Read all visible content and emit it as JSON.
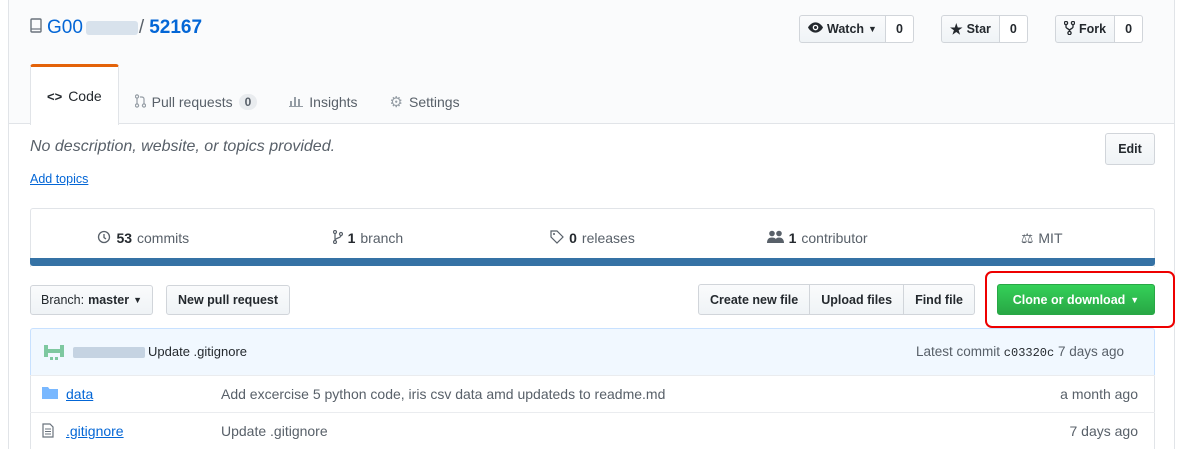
{
  "repo": {
    "owner": "G00",
    "separator": "/",
    "name": "52167"
  },
  "social": {
    "watch": {
      "label": "Watch",
      "count": "0"
    },
    "star": {
      "label": "Star",
      "count": "0"
    },
    "fork": {
      "label": "Fork",
      "count": "0"
    }
  },
  "tabs": [
    {
      "label": "Code",
      "icon": "code-icon"
    },
    {
      "label": "Pull requests",
      "count": "0",
      "icon": "pull-request-icon"
    },
    {
      "label": "Insights",
      "icon": "graph-icon"
    },
    {
      "label": "Settings",
      "icon": "gear-icon"
    }
  ],
  "description": "No description, website, or topics provided.",
  "add_topics": "Add topics",
  "edit_label": "Edit",
  "summary": {
    "commits": {
      "count": "53",
      "label": "commits"
    },
    "branches": {
      "count": "1",
      "label": "branch"
    },
    "releases": {
      "count": "0",
      "label": "releases"
    },
    "contributors": {
      "count": "1",
      "label": "contributor"
    },
    "license": "MIT"
  },
  "language_color": "#3572A5",
  "branch": {
    "prefix": "Branch:",
    "name": "master"
  },
  "new_pr_label": "New pull request",
  "file_actions": {
    "create": "Create new file",
    "upload": "Upload files",
    "find": "Find file"
  },
  "clone_label": "Clone or download",
  "latest_commit": {
    "message": "Update .gitignore",
    "prefix": "Latest commit",
    "sha": "c03320c",
    "age": "7 days ago"
  },
  "files": [
    {
      "name": "data",
      "type": "folder",
      "message": "Add excercise 5 python code, iris csv data amd updateds to readme.md",
      "age": "a month ago"
    },
    {
      "name": ".gitignore",
      "type": "file",
      "message": "Update .gitignore",
      "age": "7 days ago"
    }
  ],
  "colors": {
    "link": "#0366d6",
    "clone_green": "#28a745",
    "highlight": "#e00000",
    "tab_accent": "#e36209"
  }
}
